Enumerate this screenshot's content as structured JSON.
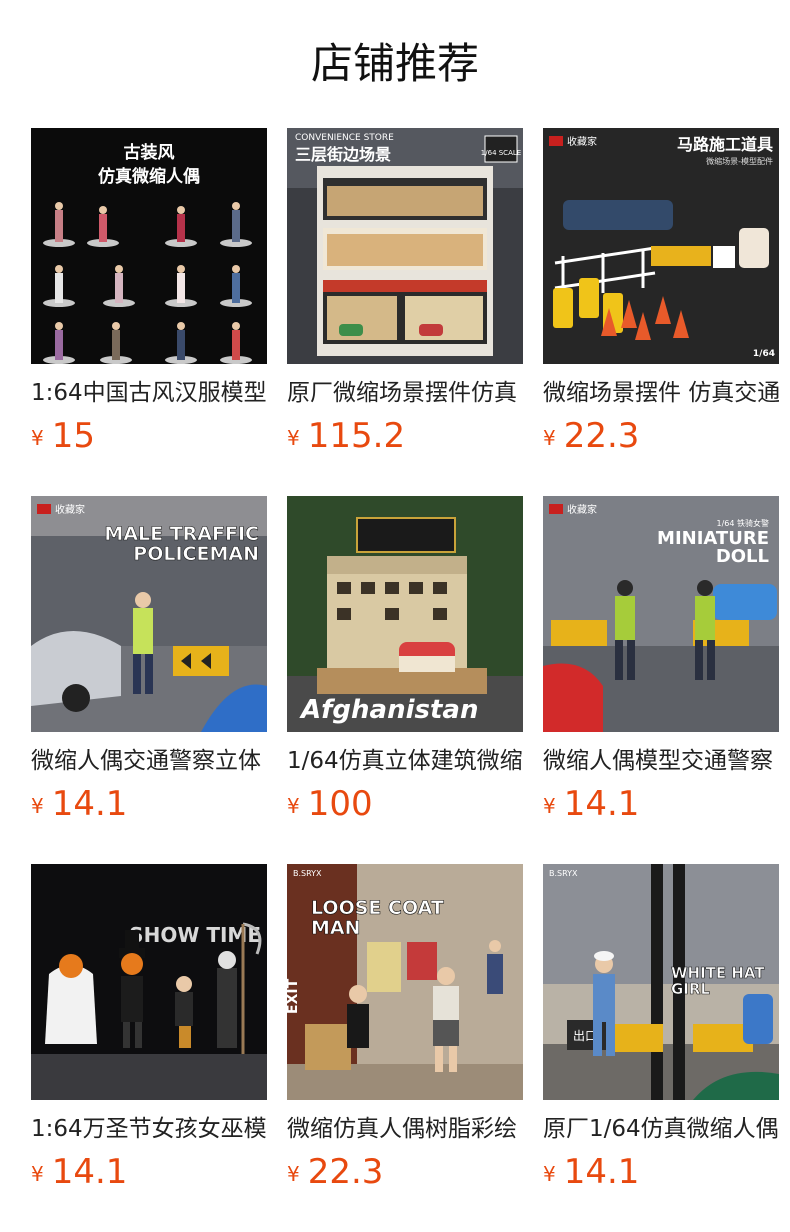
{
  "header": {
    "title": "店铺推荐"
  },
  "products": [
    {
      "name": "1:64中国古风汉服模型",
      "currency": "¥",
      "price": "15",
      "image": {
        "icon": "ancient-costume-figures-image",
        "texts": [
          "古装风",
          "仿真微缩人偶"
        ]
      }
    },
    {
      "name": "原厂微缩场景摆件仿真",
      "currency": "¥",
      "price": "115.2",
      "image": {
        "icon": "street-building-diorama-image",
        "texts": [
          "CONVENIENCE STORE",
          "三层街边场景",
          "1/64 SCALE"
        ]
      }
    },
    {
      "name": "微缩场景摆件 仿真交通",
      "currency": "¥",
      "price": "22.3",
      "image": {
        "icon": "road-construction-props-image",
        "texts": [
          "收藏家",
          "马路施工道具",
          "微缩场景-模型配件",
          "1/64"
        ]
      }
    },
    {
      "name": "微缩人偶交通警察立体",
      "currency": "¥",
      "price": "14.1",
      "image": {
        "icon": "traffic-policeman-figure-image",
        "texts": [
          "收藏家",
          "MALE TRAFFIC",
          "POLICEMAN"
        ]
      }
    },
    {
      "name": "1/64仿真立体建筑微缩",
      "currency": "¥",
      "price": "100",
      "image": {
        "icon": "afghanistan-building-image",
        "texts": [
          "Afghanistan"
        ]
      }
    },
    {
      "name": "微缩人偶模型交通警察",
      "currency": "¥",
      "price": "14.1",
      "image": {
        "icon": "miniature-doll-police-image",
        "texts": [
          "收藏家",
          "MINIATURE",
          "DOLL",
          "1/64 铁骑女警"
        ]
      }
    },
    {
      "name": "1:64万圣节女孩女巫模",
      "currency": "¥",
      "price": "14.1",
      "image": {
        "icon": "halloween-figures-image",
        "texts": [
          "SHOW TIME"
        ]
      }
    },
    {
      "name": "微缩仿真人偶树脂彩绘",
      "currency": "¥",
      "price": "22.3",
      "image": {
        "icon": "loose-coat-man-image",
        "texts": [
          "B.SRYX",
          "LOOSE COAT",
          "MAN",
          "EXIT"
        ]
      }
    },
    {
      "name": "原厂1/64仿真微缩人偶",
      "currency": "¥",
      "price": "14.1",
      "image": {
        "icon": "white-hat-girl-image",
        "texts": [
          "B.SRYX",
          "WHITE HAT",
          "GIRL",
          "出口"
        ]
      }
    }
  ]
}
